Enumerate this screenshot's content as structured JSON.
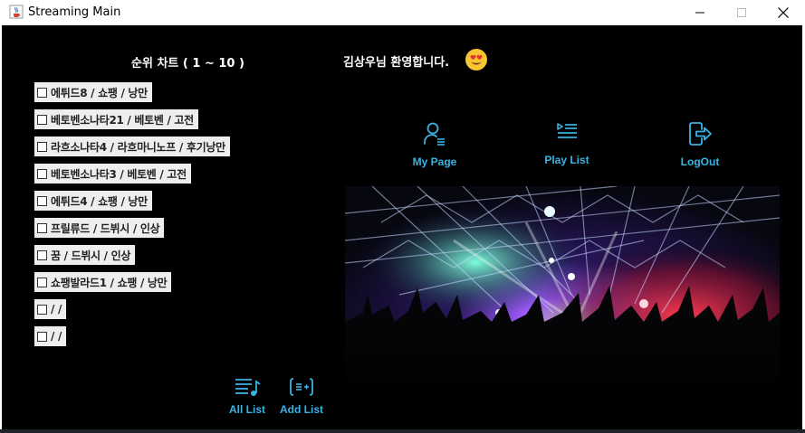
{
  "window": {
    "title": "Streaming Main",
    "minimize_icon": "minimize-icon",
    "maximize_icon": "maximize-icon",
    "close_icon": "close-icon"
  },
  "chart": {
    "title": "순위 차트 ( 1 ~ 10 )",
    "songs": [
      {
        "label": "에튀드8 / 쇼팽 / 낭만",
        "checked": false
      },
      {
        "label": "베토벤소나타21 / 베토벤 / 고전",
        "checked": false
      },
      {
        "label": "라흐소나타4 / 라흐마니노프 / 후기낭만",
        "checked": false
      },
      {
        "label": "베토벤소나타3 / 베토벤 / 고전",
        "checked": false
      },
      {
        "label": "에튀드4 / 쇼팽 / 낭만",
        "checked": false
      },
      {
        "label": "프릴류드 / 드뷔시 / 인상",
        "checked": false
      },
      {
        "label": "꿈 / 드뷔시 / 인상",
        "checked": false
      },
      {
        "label": "쇼팽발라드1 / 쇼팽 / 낭만",
        "checked": false
      },
      {
        "label": "/ /",
        "checked": false
      },
      {
        "label": "/ /",
        "checked": false
      }
    ]
  },
  "welcome": {
    "text": "김상우님 환영합니다.",
    "emoji_icon": "smiling-heart-eyes-emoji-icon"
  },
  "nav": {
    "my_page": {
      "label": "My Page",
      "icon": "user-icon"
    },
    "play_list": {
      "label": "Play List",
      "icon": "playlist-icon"
    },
    "logout": {
      "label": "LogOut",
      "icon": "logout-icon"
    }
  },
  "actions": {
    "all_list": {
      "label": "All List",
      "icon": "music-list-icon"
    },
    "add_list": {
      "label": "Add List",
      "icon": "add-list-icon"
    }
  },
  "banner": {
    "image": "concert-crowd-image"
  },
  "colors": {
    "background": "#000000",
    "accent": "#39b3e6",
    "text": "#ffffff",
    "item_bg": "#eeeeee"
  }
}
